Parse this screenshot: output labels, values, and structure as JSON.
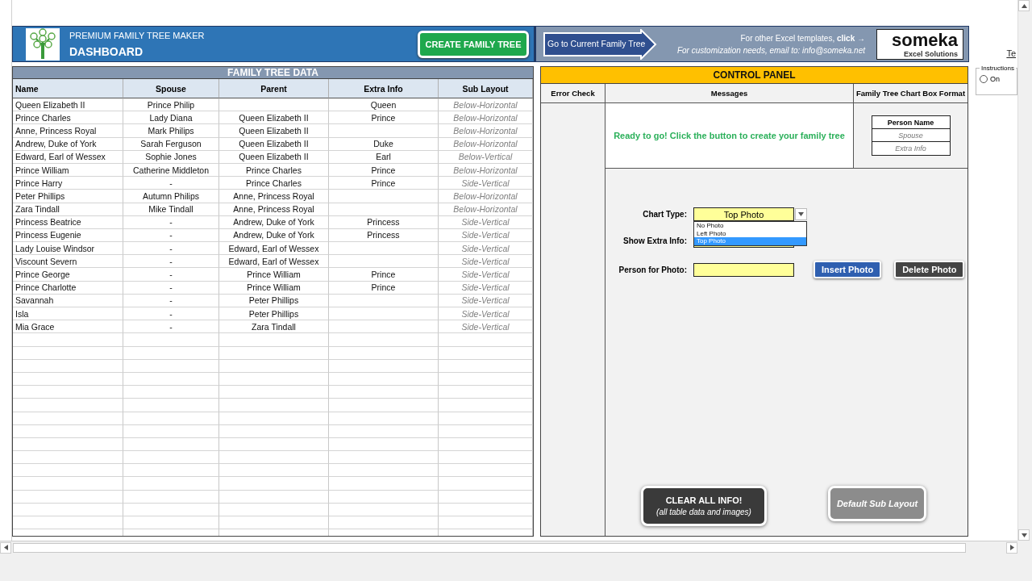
{
  "header": {
    "subtitle": "PREMIUM FAMILY TREE MAKER",
    "title": "DASHBOARD",
    "create_button": "CREATE FAMILY TREE",
    "goto_button": "Go to Current Family Tree",
    "templates_text": "For other Excel templates, **click** →",
    "email_text": "For customization needs, email to: info@someka.net",
    "brand": {
      "name": "someka",
      "tagline": "Excel Solutions"
    }
  },
  "family_table": {
    "title": "FAMILY TREE DATA",
    "columns": [
      "Name",
      "Spouse",
      "Parent",
      "Extra Info",
      "Sub Layout"
    ],
    "rows": [
      {
        "name": "Queen Elizabeth II",
        "spouse": "Prince Philip",
        "extra_info": "Queen",
        "sub_layout": "Below-Horizontal"
      },
      {
        "name": "Prince Charles",
        "spouse": "Lady Diana",
        "parent": "Queen Elizabeth II",
        "extra_info": "Prince",
        "sub_layout": "Below-Horizontal"
      },
      {
        "name": "Anne, Princess Royal",
        "spouse": "Mark Philips",
        "parent": "Queen Elizabeth II",
        "sub_layout": "Below-Horizontal"
      },
      {
        "name": "Andrew, Duke of York",
        "spouse": "Sarah Ferguson",
        "parent": "Queen Elizabeth II",
        "extra_info": "Duke",
        "sub_layout": "Below-Horizontal"
      },
      {
        "name": "Edward, Earl of Wessex",
        "spouse": "Sophie Jones",
        "parent": "Queen Elizabeth II",
        "extra_info": "Earl",
        "sub_layout": "Below-Vertical"
      },
      {
        "name": "Prince William",
        "spouse": "Catherine Middleton",
        "parent": "Prince Charles",
        "extra_info": "Prince",
        "sub_layout": "Below-Horizontal"
      },
      {
        "name": "Prince Harry",
        "spouse": "-",
        "parent": "Prince Charles",
        "extra_info": "Prince",
        "sub_layout": "Side-Vertical"
      },
      {
        "name": "Peter Phillips",
        "spouse": "Autumn Philips",
        "parent": "Anne, Princess Royal",
        "sub_layout": "Below-Horizontal"
      },
      {
        "name": "Zara Tindall",
        "spouse": "Mike Tindall",
        "parent": "Anne, Princess Royal",
        "sub_layout": "Below-Horizontal"
      },
      {
        "name": "Princess Beatrice",
        "spouse": "-",
        "parent": "Andrew, Duke of York",
        "extra_info": "Princess",
        "sub_layout": "Side-Vertical"
      },
      {
        "name": "Princess Eugenie",
        "spouse": "-",
        "parent": "Andrew, Duke of York",
        "extra_info": "Princess",
        "sub_layout": "Side-Vertical"
      },
      {
        "name": "Lady Louise Windsor",
        "spouse": "-",
        "parent": "Edward, Earl of Wessex",
        "sub_layout": "Side-Vertical"
      },
      {
        "name": "Viscount Severn",
        "spouse": "-",
        "parent": "Edward, Earl of Wessex",
        "sub_layout": "Side-Vertical"
      },
      {
        "name": "Prince George",
        "spouse": "-",
        "parent": "Prince William",
        "extra_info": "Prince",
        "sub_layout": "Side-Vertical"
      },
      {
        "name": "Prince Charlotte",
        "spouse": "-",
        "parent": "Prince William",
        "extra_info": "Prince",
        "sub_layout": "Side-Vertical"
      },
      {
        "name": "Savannah",
        "spouse": "-",
        "parent": "Peter Phillips",
        "sub_layout": "Side-Vertical"
      },
      {
        "name": "Isla",
        "spouse": "-",
        "parent": "Peter Phillips",
        "sub_layout": "Side-Vertical"
      },
      {
        "name": "Mia Grace",
        "spouse": "-",
        "parent": "Zara Tindall",
        "sub_layout": "Side-Vertical"
      }
    ]
  },
  "control_panel": {
    "title": "CONTROL PANEL",
    "columns": [
      "Error Check",
      "Messages",
      "Family Tree Chart Box Format"
    ],
    "message": "Ready to go! Click the button to create your family tree",
    "box_format": {
      "name": "Person Name",
      "spouse": "Spouse",
      "extra": "Extra Info"
    },
    "chart_type": {
      "label": "Chart Type:",
      "value": "Top Photo",
      "options": [
        {
          "label": "No Photo",
          "selected": false
        },
        {
          "label": "Left Photo",
          "selected": false
        },
        {
          "label": "Top Photo",
          "selected": true
        }
      ]
    },
    "show_extra_info": {
      "label": "Show Extra Info:"
    },
    "person_for_photo": {
      "label": "Person for Photo:"
    },
    "insert_button": "Insert Photo",
    "delete_button": "Delete Photo",
    "clear_button": {
      "title": "CLEAR ALL INFO!",
      "note": "(all table data and images)"
    },
    "default_button": "Default Sub Layout"
  },
  "side": {
    "link": "Te",
    "instructions": {
      "title": "Instructions",
      "radio": {
        "label": "On",
        "checked": false
      }
    }
  }
}
